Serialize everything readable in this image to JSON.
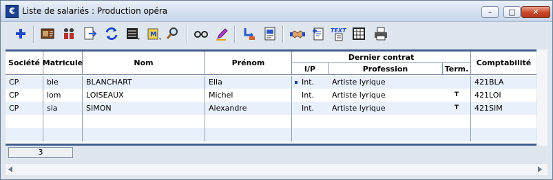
{
  "window": {
    "title": "Liste de salariés : Production opéra",
    "app_icon_glyph": "€",
    "minimize_glyph": "–",
    "maximize_glyph": "□",
    "close_glyph": "✕"
  },
  "toolbar": {
    "items": [
      "add-icon",
      "card-icon",
      "people-icon",
      "export-icon",
      "refresh-icon",
      "list-menu-icon",
      "mail-icon",
      "search-icon",
      "glasses-icon",
      "pen-icon",
      "transfer-icon",
      "import-icon",
      "handshake-icon",
      "document-plus-icon",
      "text-icon",
      "table-icon",
      "print-icon"
    ]
  },
  "table": {
    "headers": {
      "societe": "Société",
      "matricule": "Matricule",
      "nom": "Nom",
      "prenom": "Prénom",
      "dernier_contrat": "Dernier contrat",
      "ip": "I/P",
      "profession": "Profession",
      "term": "Term.",
      "comptabilite": "Comptabilité"
    },
    "rows": [
      {
        "societe": "CP",
        "matricule": "ble",
        "nom": "BLANCHART",
        "prenom": "Ella",
        "ip": "Int.",
        "profession": "Artiste lyrique",
        "term": "",
        "comptabilite": "421BLA"
      },
      {
        "societe": "CP",
        "matricule": "lom",
        "nom": "LOISEAUX",
        "prenom": "Michel",
        "ip": "Int.",
        "profession": "Artiste lyrique",
        "term": "T",
        "comptabilite": "421LOI"
      },
      {
        "societe": "CP",
        "matricule": "sia",
        "nom": "SIMON",
        "prenom": "Alexandre",
        "ip": "Int.",
        "profession": "Artiste lyrique",
        "term": "T",
        "comptabilite": "421SIM"
      }
    ],
    "selected_row": 0,
    "accent": "#3d5c8a",
    "row_alt_color": "#e8f0fb"
  },
  "status": {
    "count": "3"
  }
}
